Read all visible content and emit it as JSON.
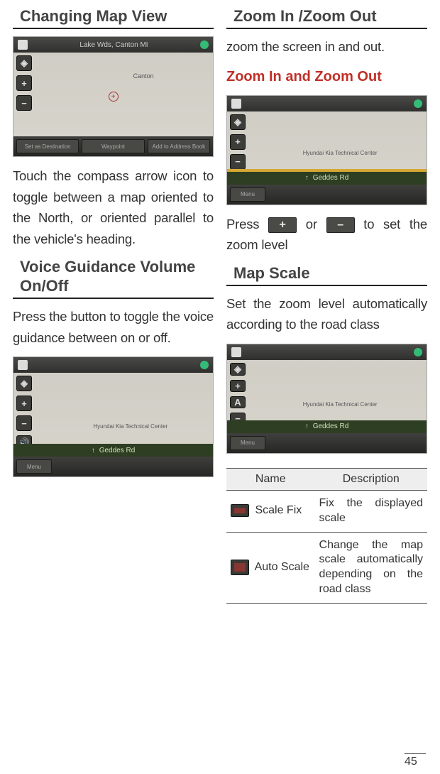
{
  "page_number": "45",
  "left": {
    "changing_map_view": {
      "heading": "Changing Map View",
      "body": "Touch the compass arrow icon to toggle between a map oriented to the North, or oriented parallel to the vehicle's heading."
    },
    "voice_guidance": {
      "heading": "Voice Guidance Volume On/Off",
      "body": "Press the button to toggle the voice guidance between on or off."
    },
    "screenshot1": {
      "top_label": "Lake Wds, Canton MI",
      "map_label": "Canton",
      "bottom_btn1": "Set as Destination",
      "bottom_btn2": "Waypoint",
      "bottom_btn3": "Add to Address Book"
    },
    "screenshot2": {
      "map_label": "Hyundai Kia Technical Center",
      "street": "Geddes Rd"
    }
  },
  "right": {
    "zoom": {
      "heading": "Zoom In /Zoom Out",
      "intro": "zoom the screen in and out.",
      "sub_red": "Zoom In and Zoom Out",
      "press_pre": "Press ",
      "press_or": " or ",
      "press_post": " to set the zoom level",
      "plus": "+",
      "minus": "–"
    },
    "map_scale": {
      "heading": "Map Scale",
      "body": "Set the zoom level automatically according to the road class",
      "table": {
        "col1": "Name",
        "col2": "Description",
        "rows": [
          {
            "name": "Scale Fix",
            "desc": "Fix the displayed scale"
          },
          {
            "name": "Auto Scale",
            "desc": "Change the map scale automatically depending on the road class"
          }
        ]
      }
    },
    "screenshot_zoom": {
      "map_label": "Hyundai Kia Technical Center",
      "street": "Geddes Rd"
    },
    "screenshot_scale": {
      "map_label": "Hyundai Kia Technical Center",
      "street": "Geddes Rd"
    }
  }
}
